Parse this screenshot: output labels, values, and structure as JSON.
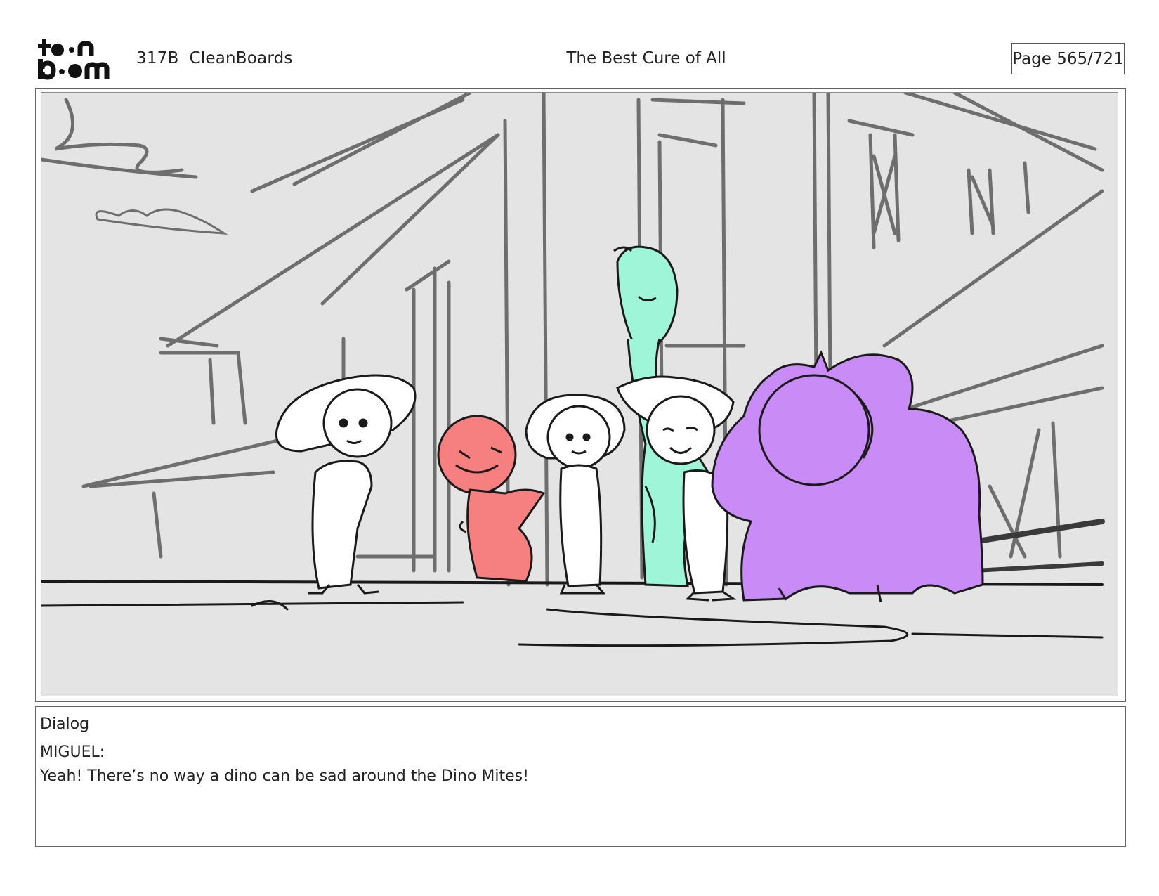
{
  "header": {
    "logo_top": "toon",
    "logo_bottom": "boom",
    "episode": "317B  CleanBoards",
    "title": "The Best Cure of All",
    "page": "Page 565/721"
  },
  "panel": {
    "colors": {
      "background": "#e4e4e4",
      "red_dino": "#f67f7f",
      "green_dino": "#9ff5d8",
      "purple_dino": "#c98bf5",
      "line_dark": "#1a1a1a",
      "line_grey": "#6e6e6e"
    }
  },
  "dialog": {
    "heading": "Dialog",
    "speaker": "MIGUEL:",
    "line": "Yeah! There’s no way a dino can be sad around the Dino Mites!"
  }
}
